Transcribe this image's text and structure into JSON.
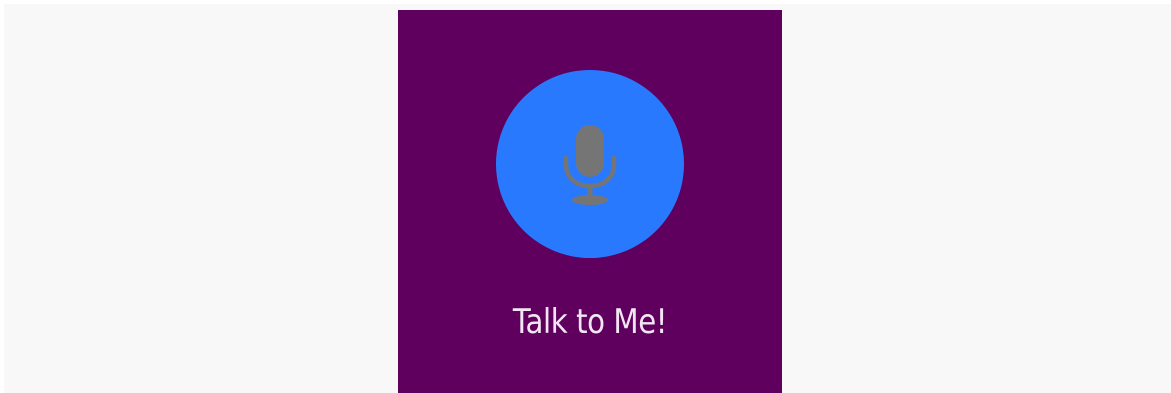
{
  "app": {
    "prompt_text": "Talk to Me!"
  },
  "mic_button": {
    "icon": "microphone-icon"
  },
  "colors": {
    "page_background": "#f8f8f8",
    "screen_background": "#5f005f",
    "button_background": "#2979ff",
    "icon_color": "#757575",
    "text_color": "#f2e6f2"
  }
}
